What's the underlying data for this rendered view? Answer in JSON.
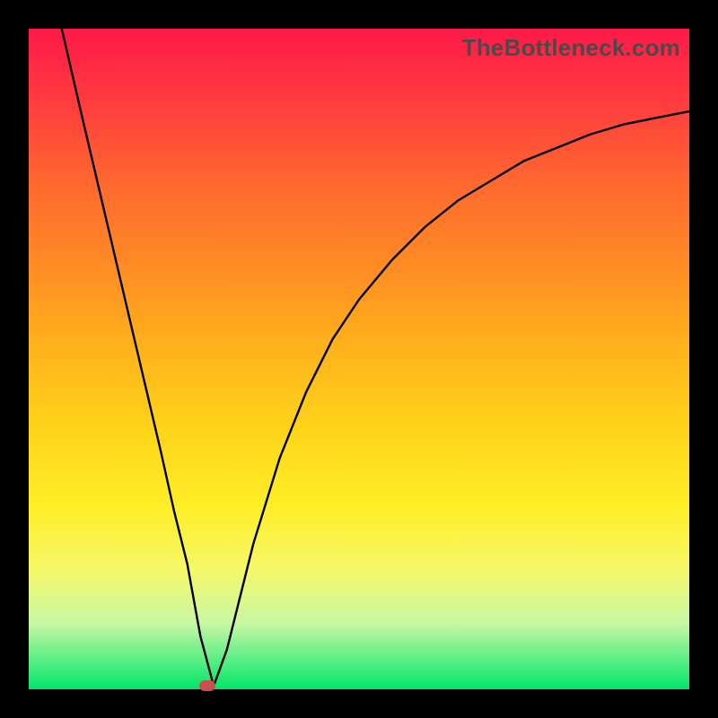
{
  "watermark": "TheBottleneck.com",
  "chart_data": {
    "type": "line",
    "title": "",
    "xlabel": "",
    "ylabel": "",
    "xlim": [
      0,
      100
    ],
    "ylim": [
      0,
      100
    ],
    "curve_x": [
      5,
      8,
      12,
      16,
      20,
      22,
      24,
      26,
      28,
      30,
      34,
      38,
      42,
      46,
      50,
      55,
      60,
      65,
      70,
      75,
      80,
      85,
      90,
      95,
      100
    ],
    "curve_y": [
      100,
      87,
      70,
      53,
      36,
      27,
      19,
      8,
      0.5,
      6,
      22,
      35,
      45,
      53,
      59,
      65,
      70,
      74,
      77,
      80,
      82,
      84,
      85.5,
      86.5,
      87.5
    ],
    "marker": {
      "x": 27,
      "y": 0.5,
      "color": "#cc4f4f"
    },
    "gradient_colors": [
      "#ff1a49",
      "#ff8c24",
      "#ffee25",
      "#00e66a"
    ]
  }
}
